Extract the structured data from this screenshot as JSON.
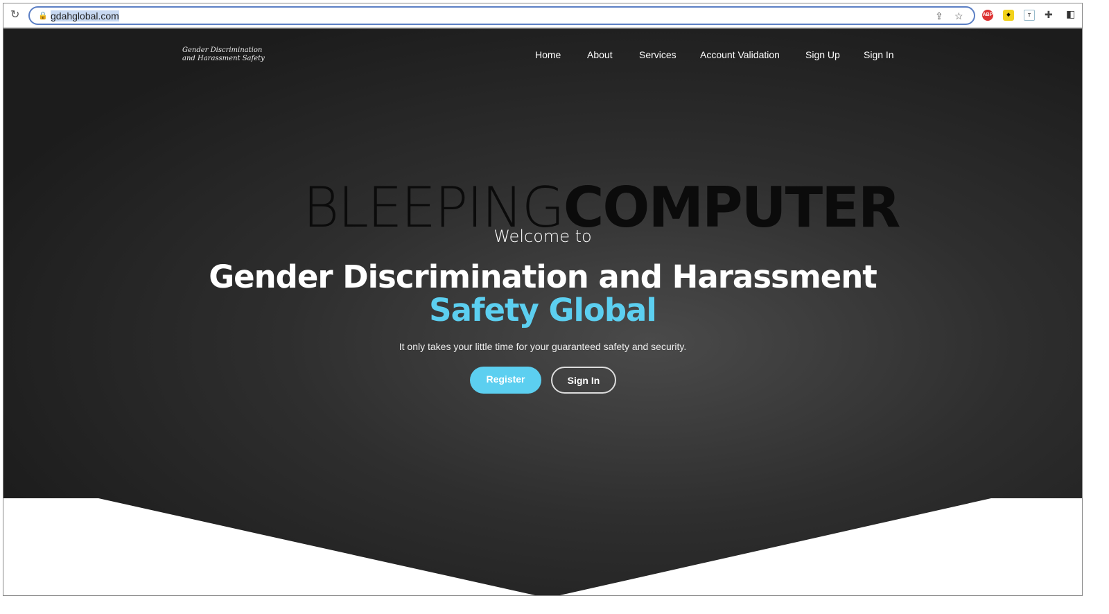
{
  "browser": {
    "url": "gdahglobal.com",
    "icons": [
      "reload-icon",
      "lock-icon",
      "share-icon",
      "star-icon",
      "adblock-icon",
      "extension-yellow-icon",
      "extension-t-icon",
      "puzzle-icon",
      "sidepanel-icon"
    ],
    "adblock_label": "ABP"
  },
  "site": {
    "logo_line1": "Gender Discrimination",
    "logo_line2": "and Harassment Safety",
    "nav": [
      "Home",
      "About",
      "Services",
      "Account Validation",
      "Sign Up",
      "Sign In"
    ],
    "watermark_light": "BLEEPING",
    "watermark_bold": "COMPUTER",
    "welcome": "Welcome to",
    "title_line1": "Gender Discrimination and Harassment",
    "title_line2": "Safety Global",
    "tagline": "It only takes your little time for your guaranteed safety and security.",
    "register_label": "Register",
    "signin_label": "Sign In",
    "accent": "#5ccff0"
  }
}
